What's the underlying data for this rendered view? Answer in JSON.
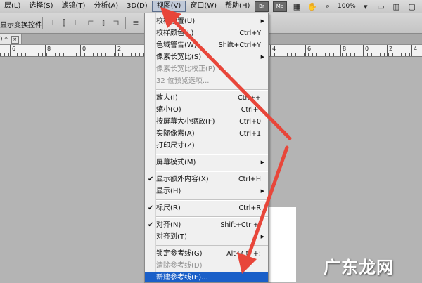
{
  "menubar": {
    "items": [
      "层(L)",
      "选择(S)",
      "滤镜(T)",
      "分析(A)",
      "3D(D)",
      "视图(V)",
      "窗口(W)",
      "帮助(H)"
    ],
    "active_index": 5,
    "tools": {
      "br": "Br",
      "mb": "Mb",
      "zoom": "100%"
    }
  },
  "options_bar": {
    "label": "显示变换控件"
  },
  "doc_tab": {
    "label": ") * ",
    "close": "×"
  },
  "ruler": {
    "numbers": [
      "6",
      "8",
      "0",
      "2",
      "4",
      "6",
      "8",
      "0",
      "2",
      "4"
    ]
  },
  "view_menu": {
    "items": [
      {
        "label": "校样设置(U)",
        "shortcut": "",
        "submenu": true,
        "disabled": false,
        "checked": false
      },
      {
        "label": "校样颜色(L)",
        "shortcut": "Ctrl+Y",
        "submenu": false,
        "disabled": false,
        "checked": false
      },
      {
        "label": "色域警告(W)",
        "shortcut": "Shift+Ctrl+Y",
        "submenu": false,
        "disabled": false,
        "checked": false
      },
      {
        "label": "像素长宽比(S)",
        "shortcut": "",
        "submenu": true,
        "disabled": false,
        "checked": false
      },
      {
        "label": "像素长宽比校正(P)",
        "shortcut": "",
        "submenu": false,
        "disabled": true,
        "checked": false
      },
      {
        "label": "32 位预览选项...",
        "shortcut": "",
        "submenu": false,
        "disabled": true,
        "checked": false
      },
      {
        "sep": true
      },
      {
        "label": "放大(I)",
        "shortcut": "Ctrl++",
        "submenu": false,
        "disabled": false,
        "checked": false
      },
      {
        "label": "缩小(O)",
        "shortcut": "Ctrl+-",
        "submenu": false,
        "disabled": false,
        "checked": false
      },
      {
        "label": "按屏幕大小缩放(F)",
        "shortcut": "Ctrl+0",
        "submenu": false,
        "disabled": false,
        "checked": false
      },
      {
        "label": "实际像素(A)",
        "shortcut": "Ctrl+1",
        "submenu": false,
        "disabled": false,
        "checked": false
      },
      {
        "label": "打印尺寸(Z)",
        "shortcut": "",
        "submenu": false,
        "disabled": false,
        "checked": false
      },
      {
        "sep": true
      },
      {
        "label": "屏幕模式(M)",
        "shortcut": "",
        "submenu": true,
        "disabled": false,
        "checked": false
      },
      {
        "sep": true
      },
      {
        "label": "显示额外内容(X)",
        "shortcut": "Ctrl+H",
        "submenu": false,
        "disabled": false,
        "checked": true
      },
      {
        "label": "显示(H)",
        "shortcut": "",
        "submenu": true,
        "disabled": false,
        "checked": false
      },
      {
        "sep": true
      },
      {
        "label": "标尺(R)",
        "shortcut": "Ctrl+R",
        "submenu": false,
        "disabled": false,
        "checked": true
      },
      {
        "sep": true
      },
      {
        "label": "对齐(N)",
        "shortcut": "Shift+Ctrl+;",
        "submenu": false,
        "disabled": false,
        "checked": true
      },
      {
        "label": "对齐到(T)",
        "shortcut": "",
        "submenu": true,
        "disabled": false,
        "checked": false
      },
      {
        "sep": true
      },
      {
        "label": "锁定参考线(G)",
        "shortcut": "Alt+Ctrl+;",
        "submenu": false,
        "disabled": false,
        "checked": false
      },
      {
        "label": "清除参考线(D)",
        "shortcut": "",
        "submenu": false,
        "disabled": true,
        "checked": false
      },
      {
        "label": "新建参考线(E)...",
        "shortcut": "",
        "submenu": false,
        "disabled": false,
        "checked": false,
        "highlighted": true
      }
    ]
  },
  "watermark": {
    "text": "广东龙网"
  },
  "colors": {
    "arrow": "#e8463a",
    "highlight": "#1a5fc8"
  }
}
